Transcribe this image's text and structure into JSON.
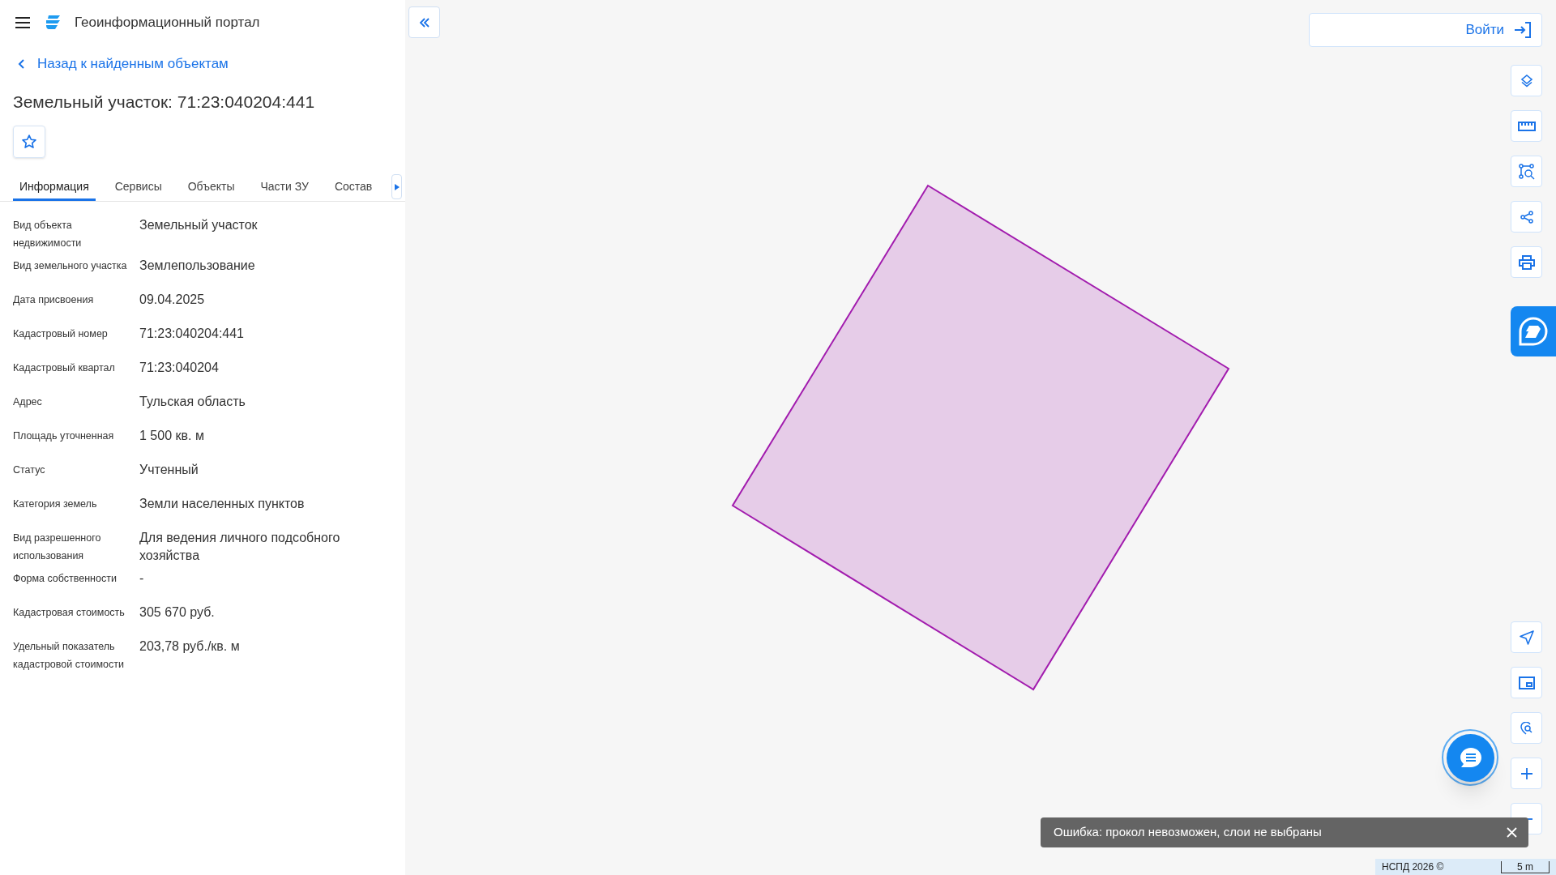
{
  "header": {
    "title": "Геоинформационный портал"
  },
  "back_link": "Назад к найденным объектам",
  "object_title": "Земельный участок: 71:23:040204:441",
  "tabs": [
    {
      "label": "Информация",
      "selected": true
    },
    {
      "label": "Сервисы",
      "selected": false
    },
    {
      "label": "Объекты",
      "selected": false
    },
    {
      "label": "Части ЗУ",
      "selected": false
    },
    {
      "label": "Состав",
      "selected": false
    }
  ],
  "properties": [
    {
      "label": "Вид объекта недвижимости",
      "value": "Земельный участок"
    },
    {
      "label": "Вид земельного участка",
      "value": "Землепользование"
    },
    {
      "label": "Дата присвоения",
      "value": "09.04.2025"
    },
    {
      "label": "Кадастровый номер",
      "value": "71:23:040204:441"
    },
    {
      "label": "Кадастровый квартал",
      "value": "71:23:040204"
    },
    {
      "label": "Адрес",
      "value": "Тульская область"
    },
    {
      "label": "Площадь уточненная",
      "value": "1 500 кв. м"
    },
    {
      "label": "Статус",
      "value": "Учтенный"
    },
    {
      "label": "Категория земель",
      "value": "Земли населенных пунктов"
    },
    {
      "label": "Вид разрешенного использования",
      "value": "Для ведения личного подсобного хозяйства"
    },
    {
      "label": "Форма собственности",
      "value": "-"
    },
    {
      "label": "Кадастровая стоимость",
      "value": "305 670 руб."
    },
    {
      "label": "Удельный показатель кадастровой стоимости",
      "value": "203,78 руб./кв. м"
    }
  ],
  "login_button": "Войти",
  "toast": {
    "message": "Ошибка: прокол невозможен, слои не выбраны"
  },
  "footer": {
    "copyright": "НСПД 2026 ©",
    "scale": "5 m"
  }
}
